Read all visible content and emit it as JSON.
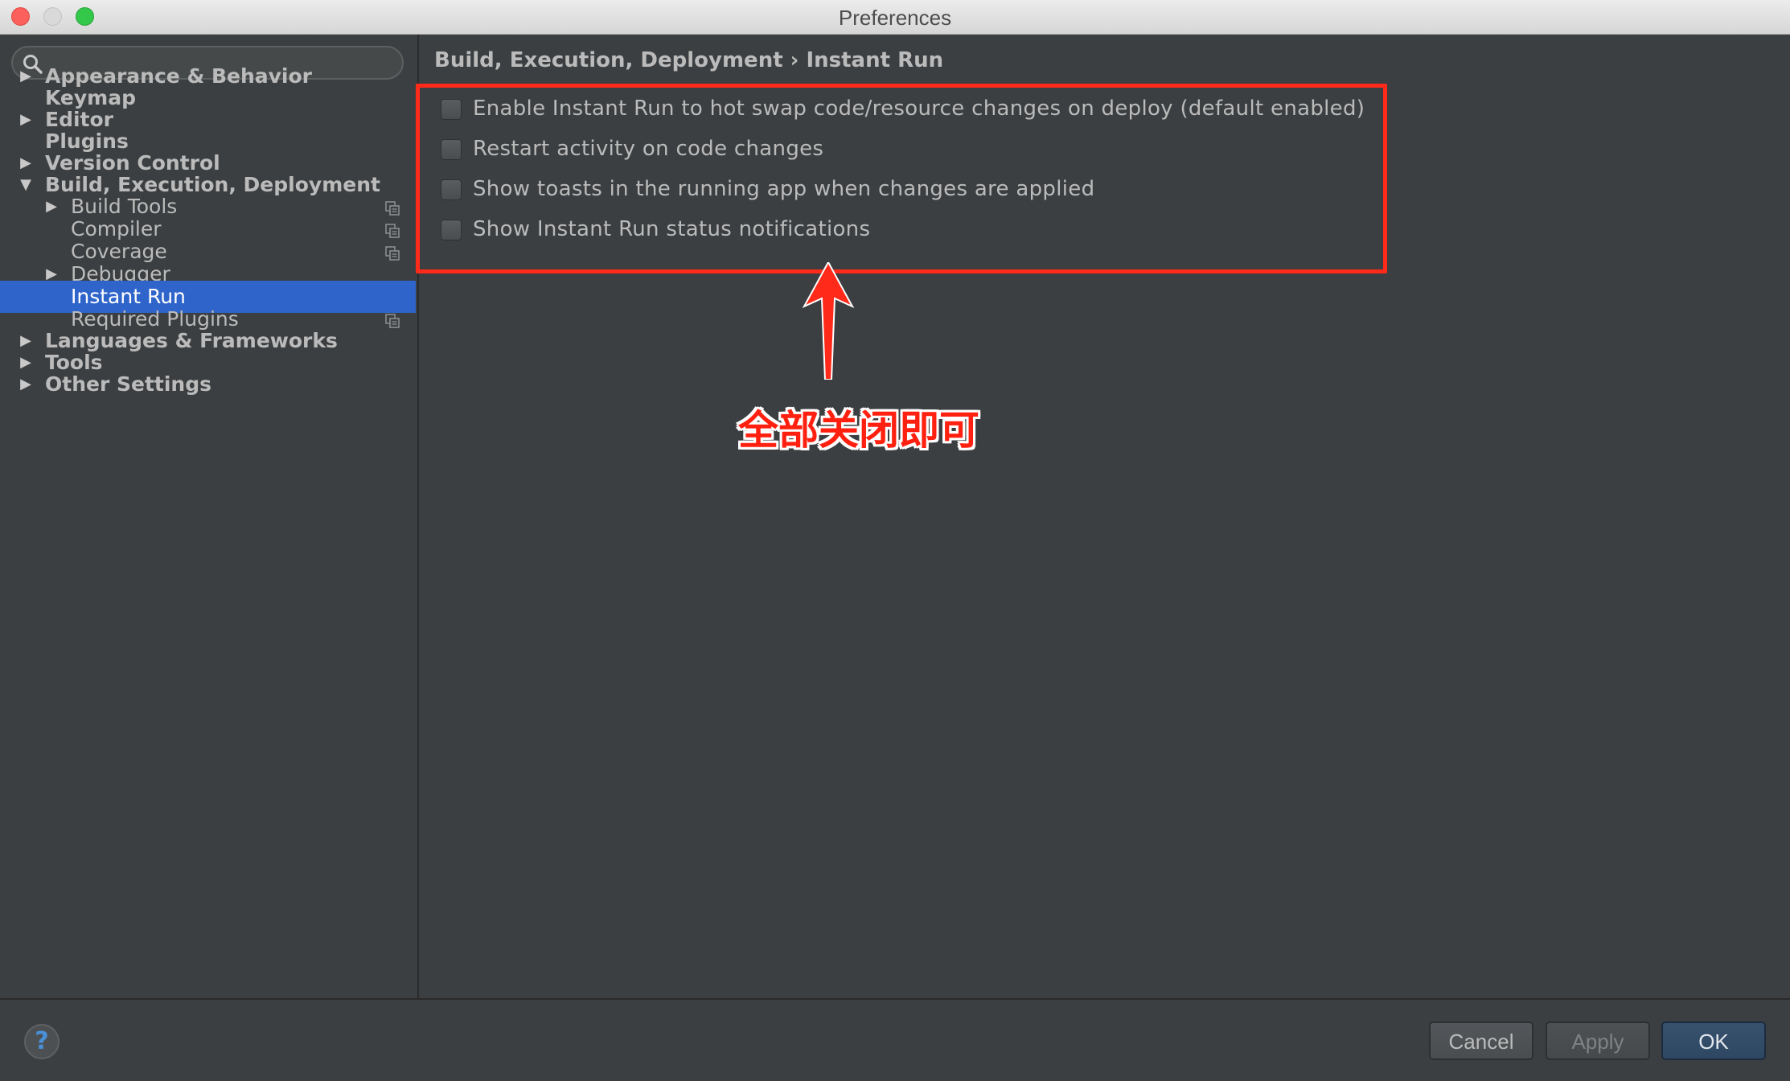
{
  "window": {
    "title": "Preferences"
  },
  "search": {
    "placeholder": "",
    "value": ""
  },
  "sidebar": {
    "items": [
      {
        "label": "Appearance & Behavior",
        "expandable": true,
        "expanded": false,
        "level": 0
      },
      {
        "label": "Keymap",
        "expandable": false,
        "level": 0
      },
      {
        "label": "Editor",
        "expandable": true,
        "expanded": false,
        "level": 0
      },
      {
        "label": "Plugins",
        "expandable": false,
        "level": 0
      },
      {
        "label": "Version Control",
        "expandable": true,
        "expanded": false,
        "level": 0
      },
      {
        "label": "Build, Execution, Deployment",
        "expandable": true,
        "expanded": true,
        "level": 0
      },
      {
        "label": "Build Tools",
        "expandable": true,
        "expanded": false,
        "level": 1,
        "project_icon": true
      },
      {
        "label": "Compiler",
        "expandable": false,
        "level": 1,
        "project_icon": true
      },
      {
        "label": "Coverage",
        "expandable": false,
        "level": 1,
        "project_icon": true
      },
      {
        "label": "Debugger",
        "expandable": true,
        "expanded": false,
        "level": 1
      },
      {
        "label": "Instant Run",
        "expandable": false,
        "level": 1,
        "selected": true
      },
      {
        "label": "Required Plugins",
        "expandable": false,
        "level": 1,
        "project_icon": true
      },
      {
        "label": "Languages & Frameworks",
        "expandable": true,
        "expanded": false,
        "level": 0
      },
      {
        "label": "Tools",
        "expandable": true,
        "expanded": false,
        "level": 0
      },
      {
        "label": "Other Settings",
        "expandable": true,
        "expanded": false,
        "level": 0
      }
    ]
  },
  "content": {
    "breadcrumb": "Build, Execution, Deployment › Instant Run",
    "options": [
      {
        "label": "Enable Instant Run to hot swap code/resource changes on deploy (default enabled)",
        "checked": false
      },
      {
        "label": "Restart activity on code changes",
        "checked": false
      },
      {
        "label": "Show toasts in the running app when changes are applied",
        "checked": false
      },
      {
        "label": "Show Instant Run status notifications",
        "checked": false
      }
    ]
  },
  "annotation": {
    "text": "全部关闭即可",
    "color": "#ff2a1a"
  },
  "footer": {
    "help": "?",
    "cancel_label": "Cancel",
    "apply_label": "Apply",
    "ok_label": "OK"
  },
  "colors": {
    "background": "#3c3f41",
    "selection": "#2f65ca",
    "text": "#bbbbbb"
  }
}
